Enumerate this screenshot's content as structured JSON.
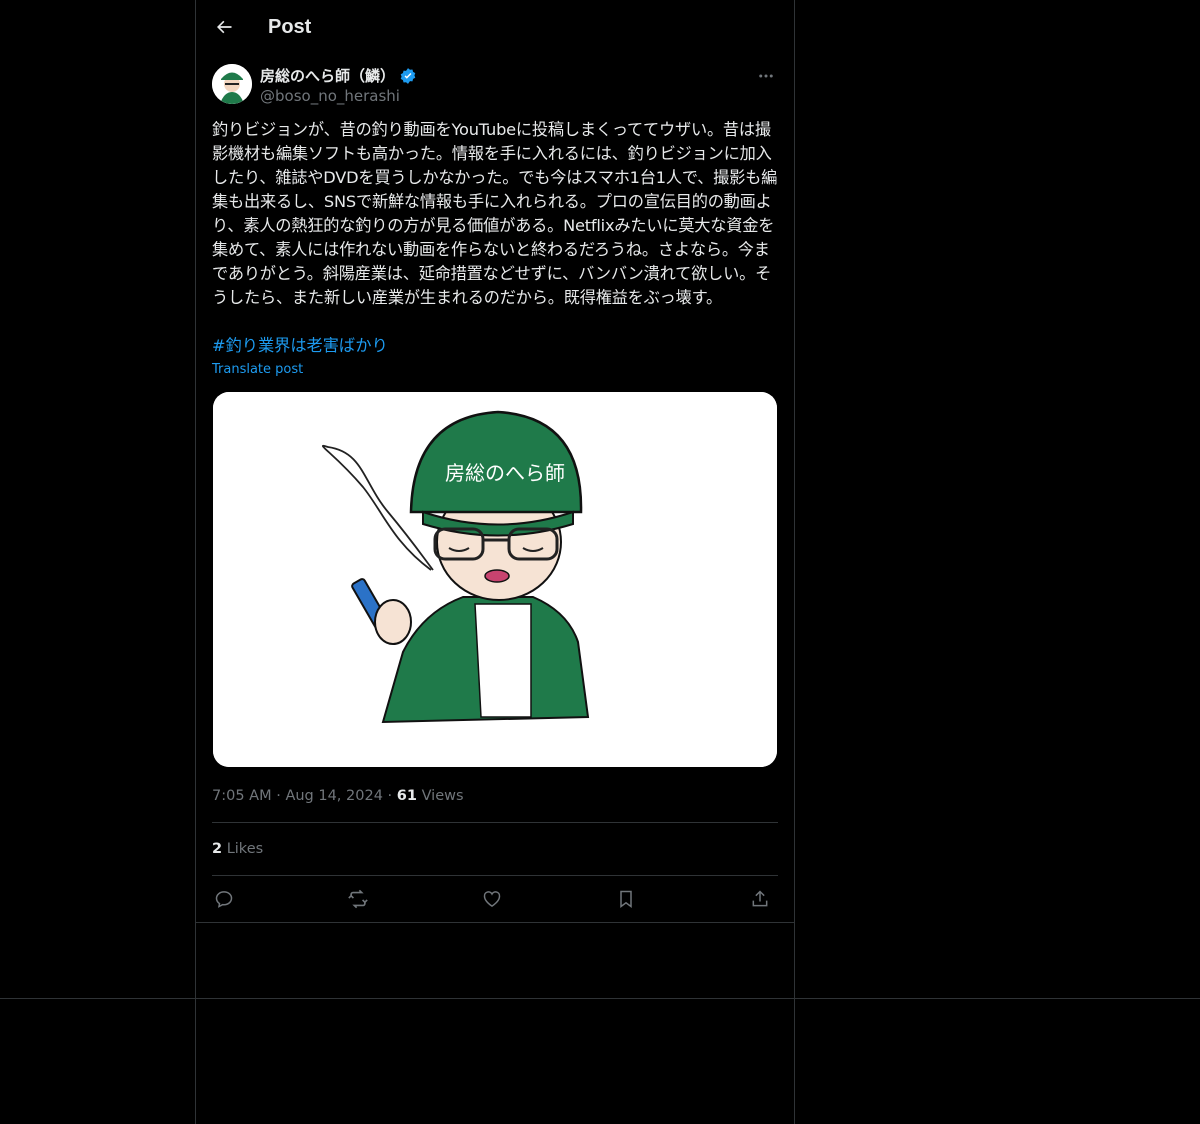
{
  "header": {
    "title": "Post"
  },
  "author": {
    "display_name": "房総のへら師（鱗）",
    "handle": "@boso_no_herashi",
    "verified": true
  },
  "post": {
    "text": "釣りビジョンが、昔の釣り動画をYouTubeに投稿しまくっててウザい。昔は撮影機材も編集ソフトも高かった。情報を手に入れるには、釣りビジョンに加入したり、雑誌やDVDを買うしかなかった。でも今はスマホ1台1人で、撮影も編集も出来るし、SNSで新鮮な情報も手に入れられる。プロの宣伝目的の動画より、素人の熱狂的な釣りの方が見る価値がある。Netflixみたいに莫大な資金を集めて、素人には作れない動画を作らないと終わるだろうね。さよなら。今までありがとう。斜陽産業は、延命措置などせずに、バンバン潰れて欲しい。そうしたら、また新しい産業が生まれるのだから。既得権益をぶっ壊す。",
    "hashtag": "#釣り業界は老害ばかり",
    "translate_label": "Translate post",
    "image_cap_text": "房総のへら師",
    "time": "7:05 AM",
    "separator": "·",
    "date": "Aug 14, 2024",
    "views_count": "61",
    "views_label": "Views",
    "likes_count": "2",
    "likes_label": "Likes"
  },
  "icons": {
    "back": "arrow-left-icon",
    "verified": "verified-badge-icon",
    "more": "more-dots-icon",
    "reply": "reply-icon",
    "repost": "repost-icon",
    "like": "heart-icon",
    "bookmark": "bookmark-icon",
    "share": "share-icon"
  },
  "colors": {
    "accent": "#1d9bf0",
    "background": "#000000",
    "border": "#2f3336",
    "muted": "#71767b",
    "cap_green": "#1f7a4a"
  }
}
